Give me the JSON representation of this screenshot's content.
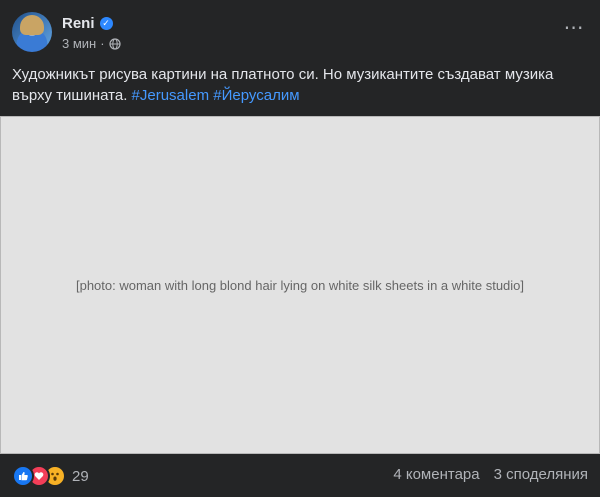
{
  "post": {
    "author": "Reni",
    "time": "3 мин",
    "separator": "·",
    "text_main": "Художникът рисува картини на платното си. Но музикантите създават музика върху тишината. ",
    "hashtags": [
      "#Jerusalem",
      "#Йерусалим"
    ],
    "more_menu": "⋯"
  },
  "media": {
    "placeholder": "[photo: woman with long blond hair lying on white silk sheets in a white studio]"
  },
  "footer": {
    "reaction_count": "29",
    "comments": "4 коментара",
    "shares": "3 споделяния"
  },
  "icons": {
    "verified": "verified-badge-icon",
    "audience": "globe-icon",
    "reactions": [
      "like-icon",
      "love-icon",
      "wow-icon"
    ]
  },
  "colors": {
    "background": "#242526",
    "text": "#e4e6eb",
    "secondary_text": "#b0b3b8",
    "hashtag": "#4599ff",
    "verified": "#2d88ff",
    "like": "#1877f2",
    "love": "#f33e58",
    "wow": "#f7b125"
  }
}
